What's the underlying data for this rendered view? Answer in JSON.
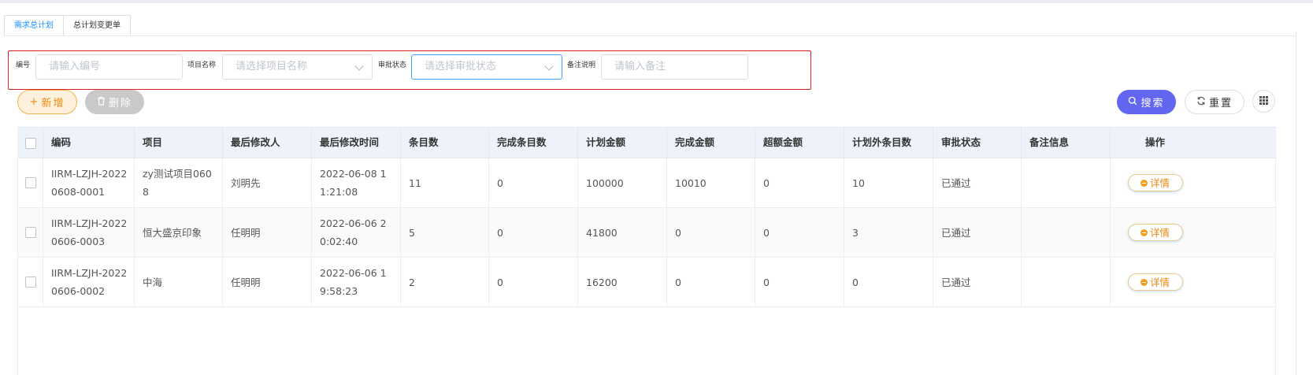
{
  "tabs": [
    {
      "label": "需求总计划",
      "active": true
    },
    {
      "label": "总计划变更单",
      "active": false
    }
  ],
  "filters": {
    "code": {
      "label": "编号",
      "placeholder": "请输入编号"
    },
    "project": {
      "label": "项目名称",
      "placeholder": "请选择项目名称"
    },
    "status": {
      "label": "审批状态",
      "placeholder": "请选择审批状态"
    },
    "remark": {
      "label": "备注说明",
      "placeholder": "请输入备注"
    }
  },
  "toolbar": {
    "add_label": "新增",
    "delete_label": "删除",
    "search_label": "搜索",
    "reset_label": "重置"
  },
  "table": {
    "columns": [
      "编码",
      "项目",
      "最后修改人",
      "最后修改时间",
      "条目数",
      "完成条目数",
      "计划金额",
      "完成金额",
      "超额金额",
      "计划外条目数",
      "审批状态",
      "备注信息",
      "操作"
    ],
    "rows": [
      {
        "code": "IIRM-LZJH-20220608-0001",
        "project": "zy测试项目0608",
        "modifier": "刘明先",
        "time": "2022-06-08 11:21:08",
        "items": "11",
        "done_items": "0",
        "plan_amount": "100000",
        "done_amount": "10010",
        "over_amount": "0",
        "extra_items": "10",
        "status": "已通过",
        "remark": "",
        "action": "详情"
      },
      {
        "code": "IIRM-LZJH-20220606-0003",
        "project": "恒大盛京印象",
        "modifier": "任明明",
        "time": "2022-06-06 20:02:40",
        "items": "5",
        "done_items": "0",
        "plan_amount": "41800",
        "done_amount": "0",
        "over_amount": "0",
        "extra_items": "3",
        "status": "已通过",
        "remark": "",
        "action": "详情"
      },
      {
        "code": "IIRM-LZJH-20220606-0002",
        "project": "中海",
        "modifier": "任明明",
        "time": "2022-06-06 19:58:23",
        "items": "2",
        "done_items": "0",
        "plan_amount": "16200",
        "done_amount": "0",
        "over_amount": "0",
        "extra_items": "0",
        "status": "已通过",
        "remark": "",
        "action": "详情"
      }
    ]
  },
  "colors": {
    "accent": "#6366f1",
    "warning": "#e98b12",
    "highlight_border": "#e02020",
    "link": "#1890ff"
  }
}
